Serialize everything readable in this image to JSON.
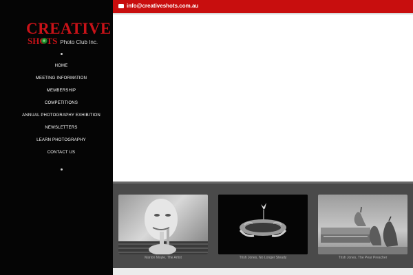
{
  "header": {
    "email": "info@creativeshots.com.au"
  },
  "logo": {
    "line1": "CREATIVE",
    "line2": "SHOTS",
    "subtitle": "Photo Club Inc."
  },
  "nav": {
    "items": [
      "HOME",
      "MEETING INFORMATION",
      "MEMBERSHIP",
      "COMPETITIONS",
      "ANNUAL PHOTOGRAPHY EXHIBITION",
      "NEWSLETTERS",
      "LEARN PHOTOGRAPHY",
      "CONTACT US"
    ]
  },
  "gallery": {
    "items": [
      {
        "caption": "Marion Moyle, The Artist"
      },
      {
        "caption": "Trish Jones, No Longer Steady"
      },
      {
        "caption": "Trish Jones, The Pear Preacher"
      }
    ]
  }
}
